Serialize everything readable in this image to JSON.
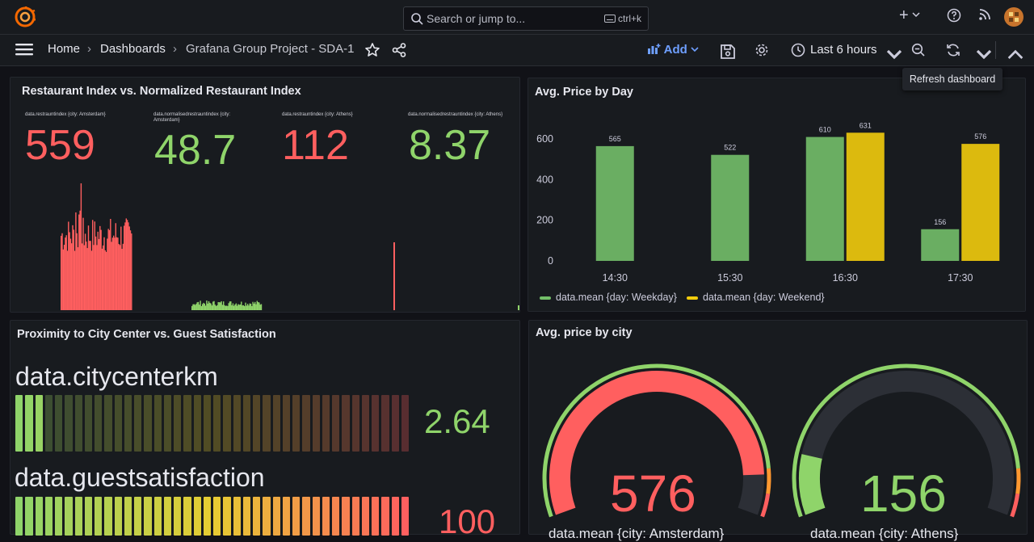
{
  "topbar": {
    "search_placeholder": "Search or jump to...",
    "shortcut": "ctrl+k",
    "new_label": "+"
  },
  "breadcrumb": {
    "home": "Home",
    "dashboards": "Dashboards",
    "current": "Grafana Group Project - SDA-1"
  },
  "toolbar": {
    "add_label": "Add",
    "time_range": "Last 6 hours",
    "tooltip": "Refresh dashboard"
  },
  "panels": {
    "restaurant": {
      "title": "Restaurant Index vs. Normalized Restaurant Index",
      "stats": [
        {
          "label": "data.restrauntindex {city: Amsterdam}",
          "value": "559",
          "color": "#ff5f5f"
        },
        {
          "label": "data.normalisedrestrauntindex {city: Amsterdam}",
          "value": "48.7",
          "color": "#8fd46a"
        },
        {
          "label": "data.restrauntindex {city: Athens}",
          "value": "112",
          "color": "#ff5f5f"
        },
        {
          "label": "data.normalisedrestrauntindex {city: Athens}",
          "value": "8.37",
          "color": "#8fd46a"
        }
      ]
    },
    "price_day": {
      "title": "Avg. Price by Day",
      "legend": [
        "data.mean {day: Weekday}",
        "data.mean {day: Weekend}"
      ]
    },
    "proximity": {
      "title": "Proximity to City Center vs. Guest Satisfaction",
      "bars": [
        {
          "label": "data.citycenterkm",
          "value": "2.64",
          "fill": 0.08,
          "color": "#8fd46a"
        },
        {
          "label": "data.guestsatisfaction",
          "value": "100",
          "fill": 1.0,
          "color": "#ff5f5f"
        }
      ]
    },
    "price_city": {
      "title": "Avg. price by city",
      "gauges": [
        {
          "label": "data.mean {city: Amsterdam}",
          "value": "576",
          "fill": 0.9,
          "color": "#ff5f5f"
        },
        {
          "label": "data.mean {city: Athens}",
          "value": "156",
          "fill": 0.15,
          "color": "#8fd46a"
        }
      ]
    }
  },
  "colors": {
    "weekday": "#73bf69",
    "weekend": "#f2cc0c",
    "red": "#ff5f5f",
    "green": "#8fd46a",
    "accent": "#6e9fff"
  },
  "chart_data": {
    "type": "bar",
    "categories": [
      "14:30",
      "15:30",
      "16:30",
      "17:30"
    ],
    "series": [
      {
        "name": "data.mean {day: Weekday}",
        "values": [
          565,
          522,
          610,
          156
        ]
      },
      {
        "name": "data.mean {day: Weekend}",
        "values": [
          null,
          null,
          631,
          576
        ]
      }
    ],
    "title": "Avg. Price by Day",
    "xlabel": "",
    "ylabel": "",
    "ylim": [
      0,
      660
    ],
    "yticks": [
      0,
      200,
      400,
      600
    ],
    "legend": "bottom-left"
  }
}
